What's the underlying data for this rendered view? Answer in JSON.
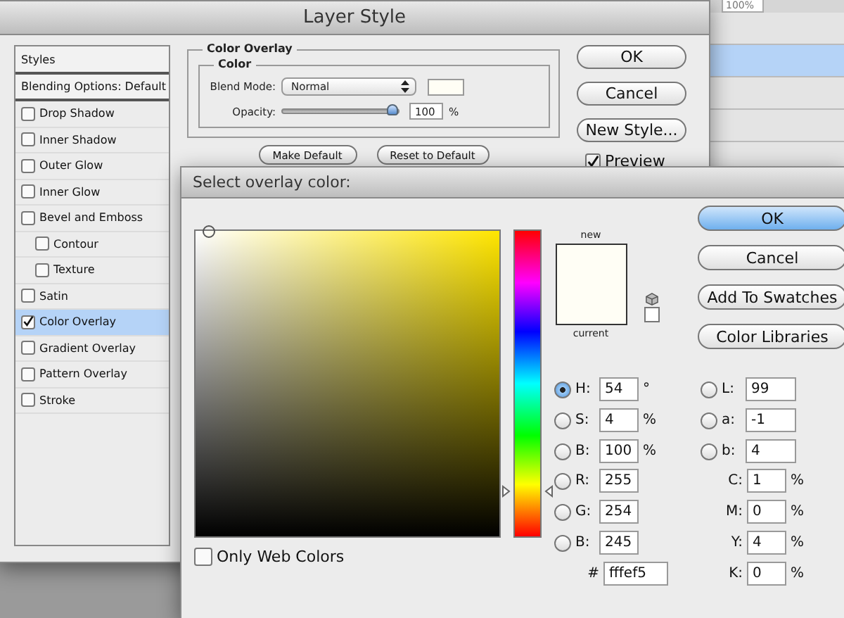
{
  "background_panel": {
    "zoom_value": "100%"
  },
  "layer_style": {
    "title": "Layer Style",
    "list_header": "Styles",
    "blending": "Blending Options: Default",
    "effects": [
      {
        "label": "Drop Shadow",
        "checked": false,
        "selected": false
      },
      {
        "label": "Inner Shadow",
        "checked": false,
        "selected": false
      },
      {
        "label": "Outer Glow",
        "checked": false,
        "selected": false
      },
      {
        "label": "Inner Glow",
        "checked": false,
        "selected": false
      },
      {
        "label": "Bevel and Emboss",
        "checked": false,
        "selected": false,
        "children": [
          {
            "label": "Contour",
            "checked": false,
            "selected": false
          },
          {
            "label": "Texture",
            "checked": false,
            "selected": false
          }
        ]
      },
      {
        "label": "Satin",
        "checked": false,
        "selected": false
      },
      {
        "label": "Color Overlay",
        "checked": true,
        "selected": true
      },
      {
        "label": "Gradient Overlay",
        "checked": false,
        "selected": false
      },
      {
        "label": "Pattern Overlay",
        "checked": false,
        "selected": false
      },
      {
        "label": "Stroke",
        "checked": false,
        "selected": false
      }
    ],
    "overlay": {
      "legend": "Color Overlay",
      "color_legend": "Color",
      "blend_label": "Blend Mode:",
      "blend_value": "Normal",
      "opacity_label": "Opacity:",
      "opacity": {
        "level": 1,
        "value": "100",
        "unit": "%"
      }
    },
    "buttons": [
      "Make Default",
      "Reset to Default"
    ],
    "side_buttons": [
      "OK",
      "Cancel",
      "New Style..."
    ],
    "preview": {
      "label": "Preview",
      "checked": true
    }
  },
  "color_picker": {
    "title": "Select overlay color:",
    "hue_slider": {
      "level": 0.15
    },
    "new_label": "new",
    "current_label": "current",
    "buttons": [
      {
        "label": "OK",
        "default": true
      },
      {
        "label": "Cancel",
        "default": false
      },
      {
        "label": "Add To Swatches",
        "default": false
      },
      {
        "label": "Color Libraries",
        "default": false
      }
    ],
    "hsb": [
      {
        "label": "H:",
        "value": "54",
        "unit": "°",
        "selected": true
      },
      {
        "label": "S:",
        "value": "4",
        "unit": "%",
        "selected": false
      },
      {
        "label": "B:",
        "value": "100",
        "unit": "%",
        "selected": false
      }
    ],
    "rgb": [
      {
        "label": "R:",
        "value": "255",
        "selected": false
      },
      {
        "label": "G:",
        "value": "254",
        "selected": false
      },
      {
        "label": "B:",
        "value": "245",
        "selected": false
      }
    ],
    "lab": [
      {
        "label": "L:",
        "value": "99",
        "selected": false
      },
      {
        "label": "a:",
        "value": "-1",
        "selected": false
      },
      {
        "label": "b:",
        "value": "4",
        "selected": false
      }
    ],
    "cmyk": [
      {
        "label": "C:",
        "value": "1",
        "unit": "%"
      },
      {
        "label": "M:",
        "value": "0",
        "unit": "%"
      },
      {
        "label": "Y:",
        "value": "4",
        "unit": "%"
      },
      {
        "label": "K:",
        "value": "0",
        "unit": "%"
      }
    ],
    "hex": {
      "label": "#",
      "value": "fffef5"
    },
    "only_web_colors": {
      "label": "Only Web Colors",
      "checked": false
    }
  }
}
